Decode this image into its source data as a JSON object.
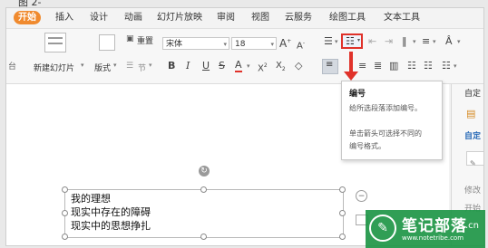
{
  "figure_caption": "图 2-",
  "menu": {
    "start": "开始",
    "tabs": [
      "插入",
      "设计",
      "动画",
      "幻灯片放映",
      "审阅",
      "视图",
      "云服务",
      "绘图工具",
      "文本工具"
    ]
  },
  "ribbon": {
    "new_slide": "新建幻灯片",
    "layout": "版式",
    "section": "节",
    "reset": "重置",
    "font_name": "宋体",
    "font_size": "18",
    "left_cut": "台"
  },
  "tooltip": {
    "title": "编号",
    "line1": "给所选段落添加编号。",
    "line2": "单击箭头可选择不同的",
    "line3": "编号格式。"
  },
  "sidebar": {
    "custom_label": "自定",
    "custom2": "自定",
    "modify": "修改",
    "start": "开始"
  },
  "textbox": {
    "lines": [
      "我的理想",
      "现实中存在的障碍",
      "现实中的思想挣扎"
    ]
  },
  "watermark": {
    "title": "笔记部落",
    "url": "www.notetribe.com",
    "cn": ".cn"
  },
  "colors": {
    "accent_orange": "#f08a2e",
    "highlight_red": "#e0322a",
    "watermark_green": "#1e9646"
  }
}
